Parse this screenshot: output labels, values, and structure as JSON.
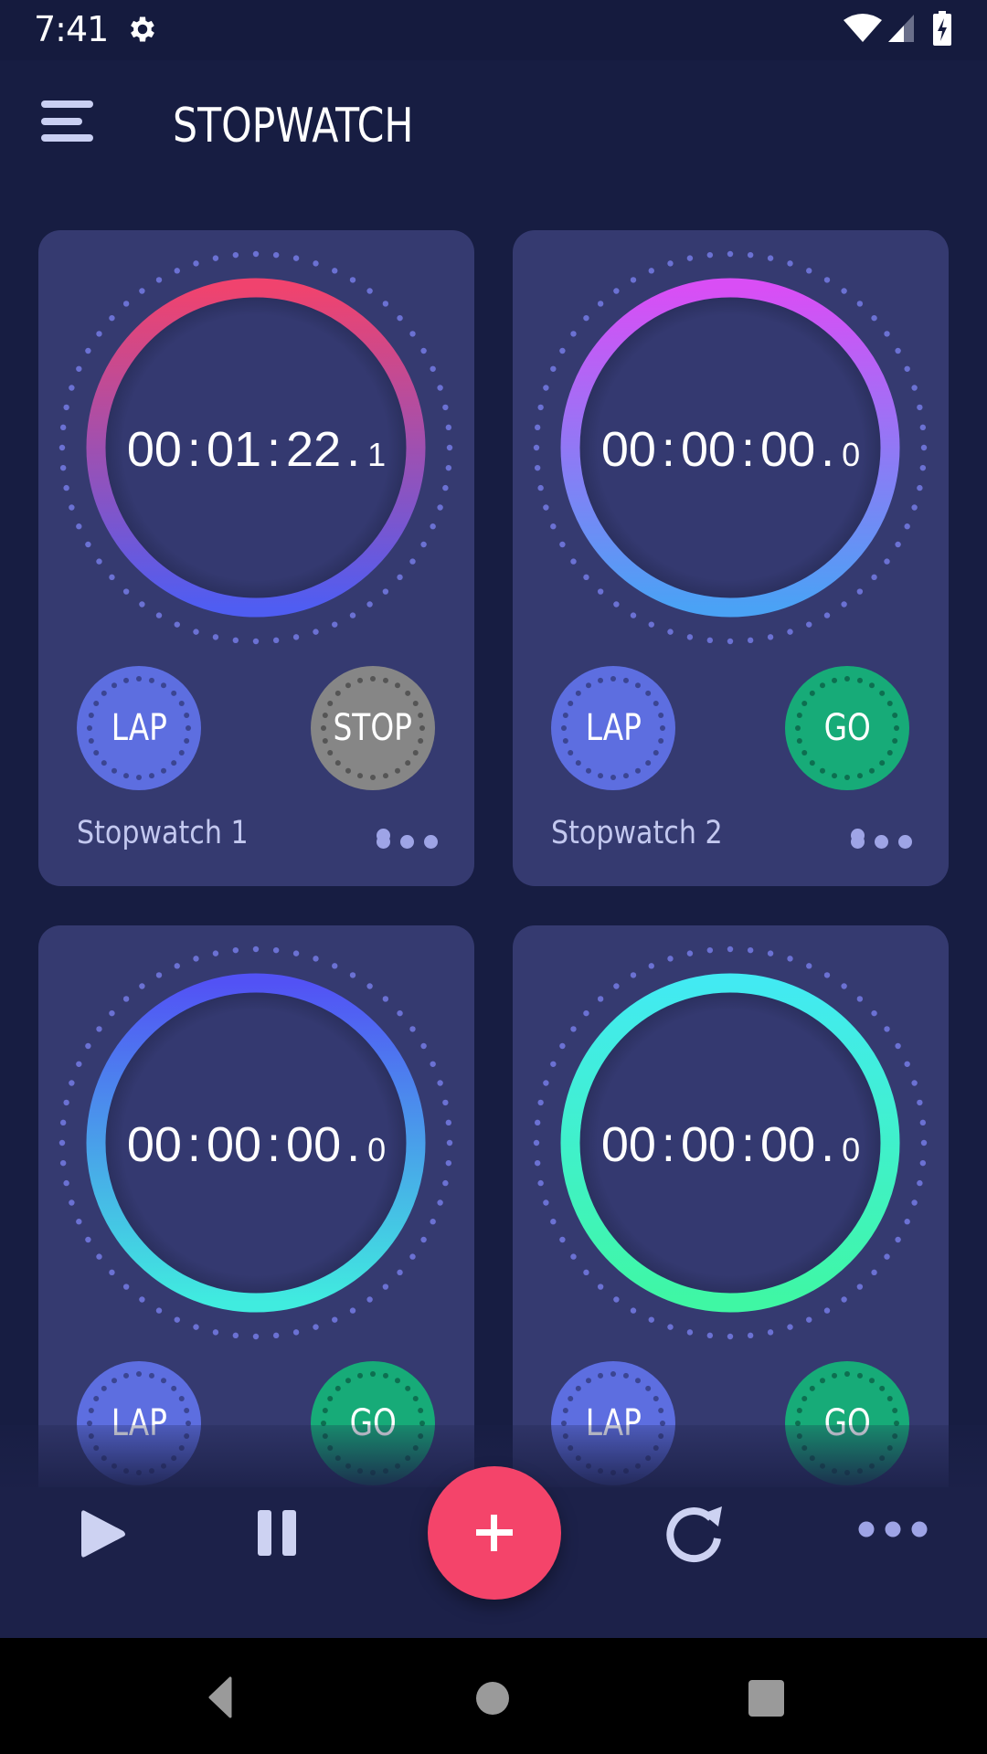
{
  "status_bar": {
    "time": "7:41",
    "icons": [
      "settings-gear-icon",
      "wifi-icon",
      "cell-signal-icon",
      "battery-charging-icon"
    ]
  },
  "header": {
    "menu_icon": "hamburger-menu-icon",
    "title": "STOPWATCH"
  },
  "colors": {
    "background": "#171d42",
    "card": "#353a70",
    "lap_button": "#5d6ee0",
    "stop_button": "#868686",
    "go_button": "#17ab78",
    "fab": "#f4446a",
    "tick_dots": "#6b71d3"
  },
  "stopwatches": [
    {
      "name": "Stopwatch 1",
      "time": {
        "hours": "00",
        "minutes": "01",
        "seconds": "22",
        "tenths": "1"
      },
      "ring_gradient": [
        "#f0436e",
        "#4f5df2"
      ],
      "lap_label": "LAP",
      "action_label": "STOP",
      "action_state": "stop",
      "more_icon": "more-horizontal-icon"
    },
    {
      "name": "Stopwatch 2",
      "time": {
        "hours": "00",
        "minutes": "00",
        "seconds": "00",
        "tenths": "0"
      },
      "ring_gradient": [
        "#d94ef5",
        "#4aa2f5"
      ],
      "lap_label": "LAP",
      "action_label": "GO",
      "action_state": "go",
      "more_icon": "more-horizontal-icon"
    },
    {
      "name": "",
      "time": {
        "hours": "00",
        "minutes": "00",
        "seconds": "00",
        "tenths": "0"
      },
      "ring_gradient": [
        "#5252f5",
        "#40ecdf"
      ],
      "lap_label": "LAP",
      "action_label": "GO",
      "action_state": "go",
      "more_icon": "more-horizontal-icon"
    },
    {
      "name": "",
      "time": {
        "hours": "00",
        "minutes": "00",
        "seconds": "00",
        "tenths": "0"
      },
      "ring_gradient": [
        "#42eaf2",
        "#3ff7a4"
      ],
      "lap_label": "LAP",
      "action_label": "GO",
      "action_state": "go",
      "more_icon": "more-horizontal-icon"
    }
  ],
  "bottom_bar": {
    "buttons": [
      {
        "name": "play-all",
        "icon": "play-icon"
      },
      {
        "name": "pause-all",
        "icon": "pause-icon"
      },
      {
        "name": "add-stopwatch",
        "icon": "plus-icon"
      },
      {
        "name": "reset-all",
        "icon": "refresh-icon"
      },
      {
        "name": "more",
        "icon": "more-horizontal-icon"
      }
    ]
  },
  "nav_bar": {
    "buttons": [
      "back-icon",
      "home-icon",
      "recents-icon"
    ]
  }
}
